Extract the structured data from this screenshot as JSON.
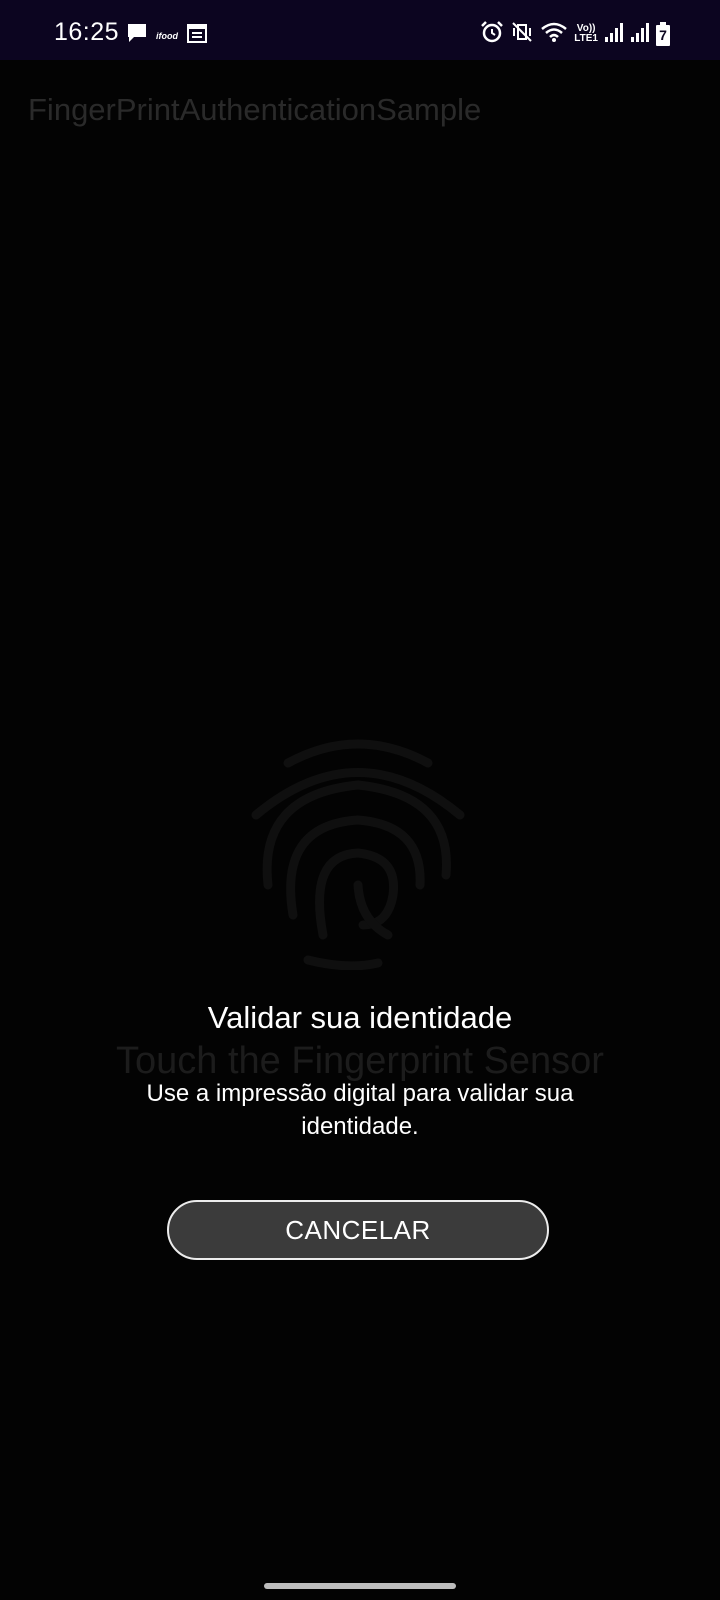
{
  "status_bar": {
    "time": "16:25",
    "left_icons": [
      "message-icon",
      "ifood-icon",
      "calendar-icon"
    ],
    "ifood_text": "ifood",
    "right_icons": [
      "alarm-icon",
      "vibrate-icon",
      "wifi-icon",
      "volte-icon",
      "signal-icon",
      "signal-icon",
      "battery-charging-icon"
    ],
    "volte_line1": "Vo))",
    "volte_line2": "LTE1",
    "battery_level": "7",
    "background": "#0c0520"
  },
  "app": {
    "title": "FingerPrintAuthenticationSample",
    "instruction": "Touch the Fingerprint Sensor"
  },
  "dialog": {
    "title": "Validar sua identidade",
    "subtitle": "Use a impressão digital para validar sua identidade.",
    "cancel_label": "CANCELAR"
  }
}
